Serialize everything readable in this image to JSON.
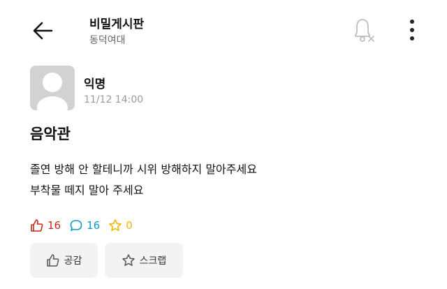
{
  "header": {
    "board_name": "비밀게시판",
    "school": "동덕여대"
  },
  "post": {
    "author": "익명",
    "timestamp": "11/12 14:00",
    "title": "음악관",
    "body_lines": [
      "졸연 방해 안 할테니까 시위 방해하지 말아주세요",
      "부착물 떼지 말아 주세요"
    ]
  },
  "stats": {
    "likes": "16",
    "comments": "16",
    "scraps": "0"
  },
  "actions": {
    "like_label": "공감",
    "scrap_label": "스크랩"
  },
  "colors": {
    "like": "#c62917",
    "comment": "#0b9bc7",
    "scrap": "#f2b705"
  },
  "icons": [
    "back-arrow-icon",
    "bell-off-icon",
    "more-vertical-icon",
    "thumbs-up-icon",
    "comment-icon",
    "star-icon"
  ]
}
